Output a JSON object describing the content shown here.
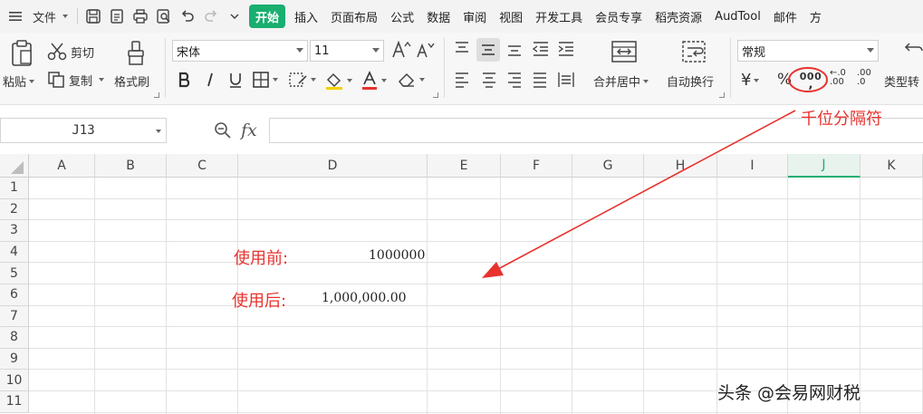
{
  "menubar": {
    "file_label": "文件",
    "tabs": [
      "开始",
      "插入",
      "页面布局",
      "公式",
      "数据",
      "审阅",
      "视图",
      "开发工具",
      "会员专享",
      "稻壳资源",
      "AudTool",
      "邮件",
      "方"
    ],
    "active_tab": "开始"
  },
  "ribbon": {
    "paste_label": "粘贴",
    "cut_label": "剪切",
    "copy_label": "复制",
    "format_painter_label": "格式刷",
    "font_name": "宋体",
    "font_size": "11",
    "merge_center_label": "合并居中",
    "wrap_text_label": "自动换行",
    "number_format": "常规",
    "currency_symbol": "¥",
    "percent_symbol": "%",
    "thousands_symbol": "000",
    "increase_decimal": ".00",
    "decrease_decimal": ".0",
    "type_convert_label": "类型转"
  },
  "formulabar": {
    "name_box": "J13",
    "fx_label": "fx"
  },
  "grid": {
    "columns": [
      "A",
      "B",
      "C",
      "D",
      "E",
      "F",
      "G",
      "H",
      "I",
      "J",
      "K"
    ],
    "active_column": "J",
    "rows": [
      "1",
      "2",
      "3",
      "4",
      "5",
      "6",
      "7",
      "8",
      "9",
      "10",
      "11"
    ],
    "before_label": "使用前:",
    "before_value": "1000000",
    "after_label": "使用后:",
    "after_value": "1,000,000.00"
  },
  "annotation": {
    "label": "千位分隔符",
    "color": "#e8322e"
  },
  "watermark": "头条 @会易网财税",
  "colors": {
    "accent": "#1aae6f",
    "annotation": "#e8322e"
  }
}
